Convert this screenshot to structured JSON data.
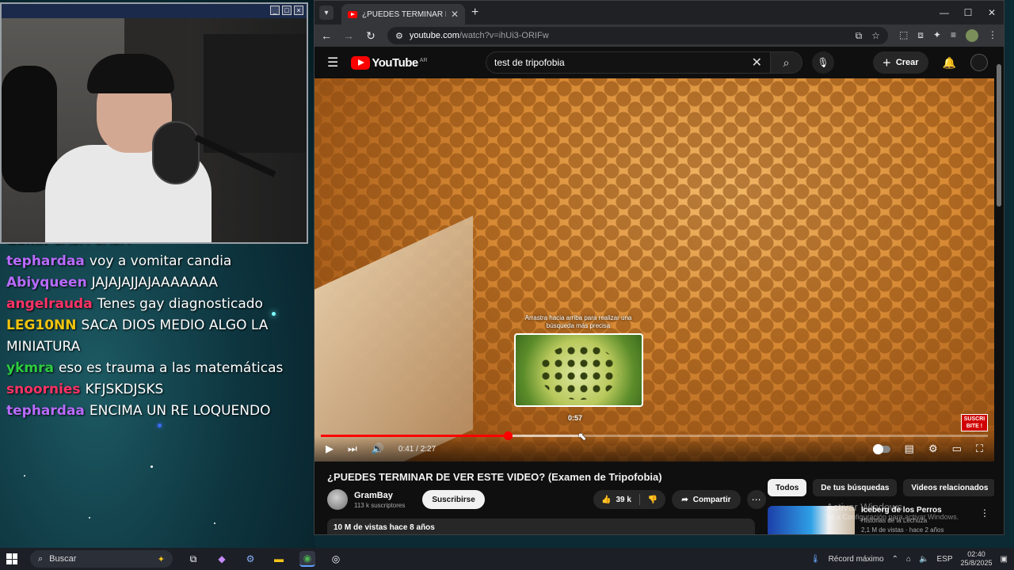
{
  "stream": {
    "chat": [
      {
        "user": "daikx",
        "user_color": "#2ecc40",
        "message": "CASA CASA"
      },
      {
        "user": "tephardaa",
        "user_color": "#b86bff",
        "message": "voy a vomitar candia"
      },
      {
        "user": "Abiyqueen",
        "user_color": "#b86bff",
        "message": "JAJAJAJJAJAAAAAAA"
      },
      {
        "user": "angelrauda",
        "user_color": "#ff3366",
        "message": "Tenes gay diagnosticado"
      },
      {
        "user": "LEG10NN",
        "user_color": "#f1c40f",
        "message": "SACA DIOS MEDIO ALGO LA MINIATURA"
      },
      {
        "user": "ykmra",
        "user_color": "#2ecc40",
        "message": "eso es trauma a las matemáticas"
      },
      {
        "user": "snoornies",
        "user_color": "#ff3366",
        "message": "KFJSKDJSKS"
      },
      {
        "user": "tephardaa",
        "user_color": "#b86bff",
        "message": "ENCIMA UN RE LOQUENDO"
      }
    ]
  },
  "browser": {
    "tab_title": "¿PUEDES TERMINAR DE VER ES",
    "url_host": "youtube.com",
    "url_rest": "/watch?v=ihUi3-ORIFw"
  },
  "youtube": {
    "logo_text": "YouTube",
    "country": "AR",
    "search_value": "test de tripofobia",
    "create_label": "Crear",
    "player": {
      "scrub_hint": "Arrastra hacia arriba para realizar una búsqueda más precisa",
      "hover_time": "0:57",
      "time_readout": "0:41 / 2:27",
      "played_fraction": 0.28,
      "buffered_fraction": 0.39,
      "subscribe_badge": "SUSCRI BITE !"
    },
    "video_title": "¿PUEDES TERMINAR DE VER ESTE VIDEO? (Examen de Tripofobia)",
    "channel_name": "GramBay",
    "channel_subs": "113 k suscriptores",
    "subscribe_label": "Suscribirse",
    "likes": "39 k",
    "share_label": "Compartir",
    "description_meta": "10 M de vistas  hace 8 años",
    "chips": [
      "Todos",
      "De tus búsquedas",
      "Videos relacionados"
    ],
    "recommended": {
      "title": "Iceberg de los Perros",
      "channel": "Historias de la Lechuza",
      "meta": "2,1 M de vistas · hace 2 años"
    },
    "activate_line1": "Activar Windows",
    "activate_line2": "Ve a Configuración para activar Windows."
  },
  "taskbar": {
    "search_placeholder": "Buscar",
    "weather": "Récord máximo",
    "lang": "ESP",
    "time": "02:40",
    "date": "25/8/2025"
  }
}
